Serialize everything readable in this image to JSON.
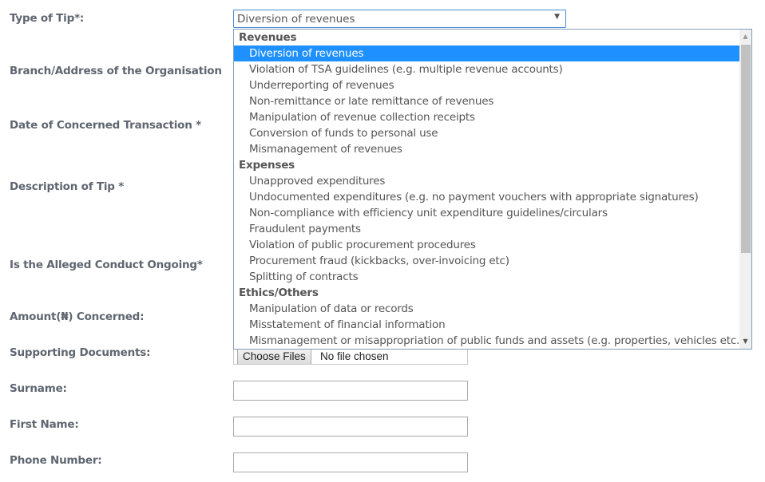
{
  "form": {
    "labels": {
      "type_of_tip": "Type of Tip*:",
      "branch_address": "Branch/Address of the Organisation",
      "date_transaction": "Date of Concerned Transaction *",
      "description": "Description of Tip *",
      "conduct_ongoing": "Is the Alleged Conduct Ongoing*",
      "amount": "Amount(₦) Concerned:",
      "supporting_docs": "Supporting Documents:",
      "surname": "Surname:",
      "first_name": "First Name:",
      "phone": "Phone Number:"
    },
    "type_of_tip": {
      "selected": "Diversion of revenues",
      "groups": [
        {
          "label": "Revenues",
          "options": [
            "Diversion of revenues",
            "Violation of TSA guidelines (e.g. multiple revenue accounts)",
            "Underreporting of revenues",
            "Non-remittance or late remittance of revenues",
            "Manipulation of revenue collection receipts",
            "Conversion of funds to personal use",
            "Mismanagement of revenues"
          ]
        },
        {
          "label": "Expenses",
          "options": [
            "Unapproved expenditures",
            "Undocumented expenditures (e.g. no payment vouchers with appropriate signatures)",
            "Non-compliance with efficiency unit expenditure guidelines/circulars",
            "Fraudulent payments",
            "Violation of public procurement procedures",
            "Procurement fraud (kickbacks, over-invoicing etc)",
            "Splitting of contracts"
          ]
        },
        {
          "label": "Ethics/Others",
          "options": [
            "Manipulation of data or records",
            "Misstatement of financial information",
            "Mismanagement or misappropriation of public funds and assets (e.g. properties, vehicles etc.)"
          ]
        }
      ]
    },
    "file_input": {
      "button_label": "Choose Files",
      "status": "No file chosen"
    },
    "surname_value": "",
    "first_name_value": "",
    "phone_value": ""
  },
  "colors": {
    "selected_bg": "#1e90ff",
    "label_text": "#5f6670",
    "focus_border": "#4a88d6"
  }
}
